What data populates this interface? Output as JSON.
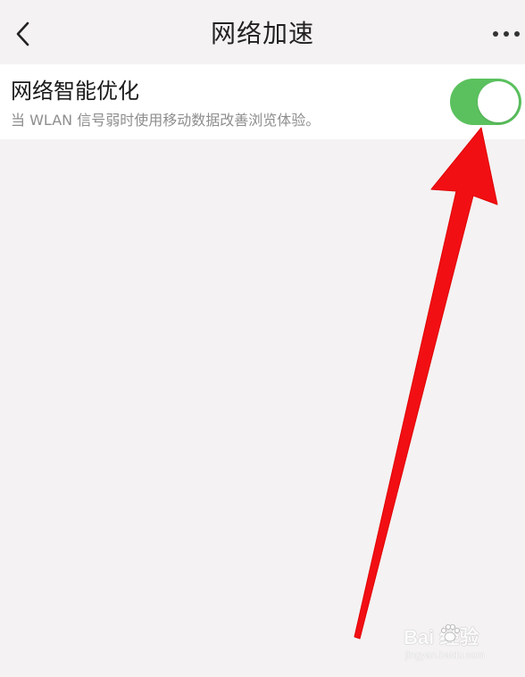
{
  "header": {
    "title": "网络加速",
    "back_icon": "chevron-left-icon",
    "more_icon": "more-dots-icon"
  },
  "setting": {
    "title": "网络智能优化",
    "description": "当 WLAN 信号弱时使用移动数据改善浏览体验。",
    "toggle_on": true,
    "toggle_color": "#5bc15e"
  },
  "annotation": {
    "arrow_color": "#f20f14"
  },
  "watermark": {
    "main": "Bai  经验",
    "sub": "jingyan.baidu.com"
  }
}
